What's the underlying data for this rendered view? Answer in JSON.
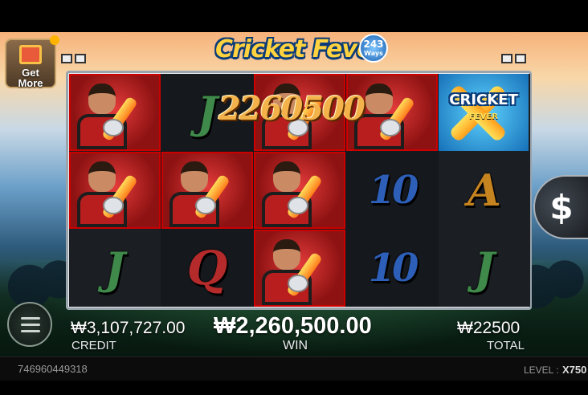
{
  "game": {
    "logo_text": "Cricket Fever",
    "ways_number": "243",
    "ways_label": "Ways"
  },
  "get_more": {
    "label_line1": "Get",
    "label_line2": "More"
  },
  "reels": [
    [
      "hero",
      "hero",
      "J"
    ],
    [
      "J",
      "hero",
      "Q"
    ],
    [
      "hero",
      "hero",
      "hero"
    ],
    [
      "hero",
      "10",
      "10"
    ],
    [
      "wild",
      "A",
      "J"
    ]
  ],
  "wild_symbol": {
    "line1": "CRICKET",
    "line2": "FEVER"
  },
  "win_display": "2260500",
  "spin_button_symbol": "$",
  "stats": {
    "credit_value": "₩3,107,727.00",
    "credit_label": "CREDIT",
    "win_value": "₩2,260,500.00",
    "win_label": "WIN",
    "total_value": "₩22500",
    "total_label": "TOTAL"
  },
  "footer": {
    "round_id": "746960449318",
    "level_label": "LEVEL :",
    "level_value": "X750"
  },
  "colors": {
    "hero_highlight": "#c00000",
    "win_text": "#f4b24a"
  }
}
